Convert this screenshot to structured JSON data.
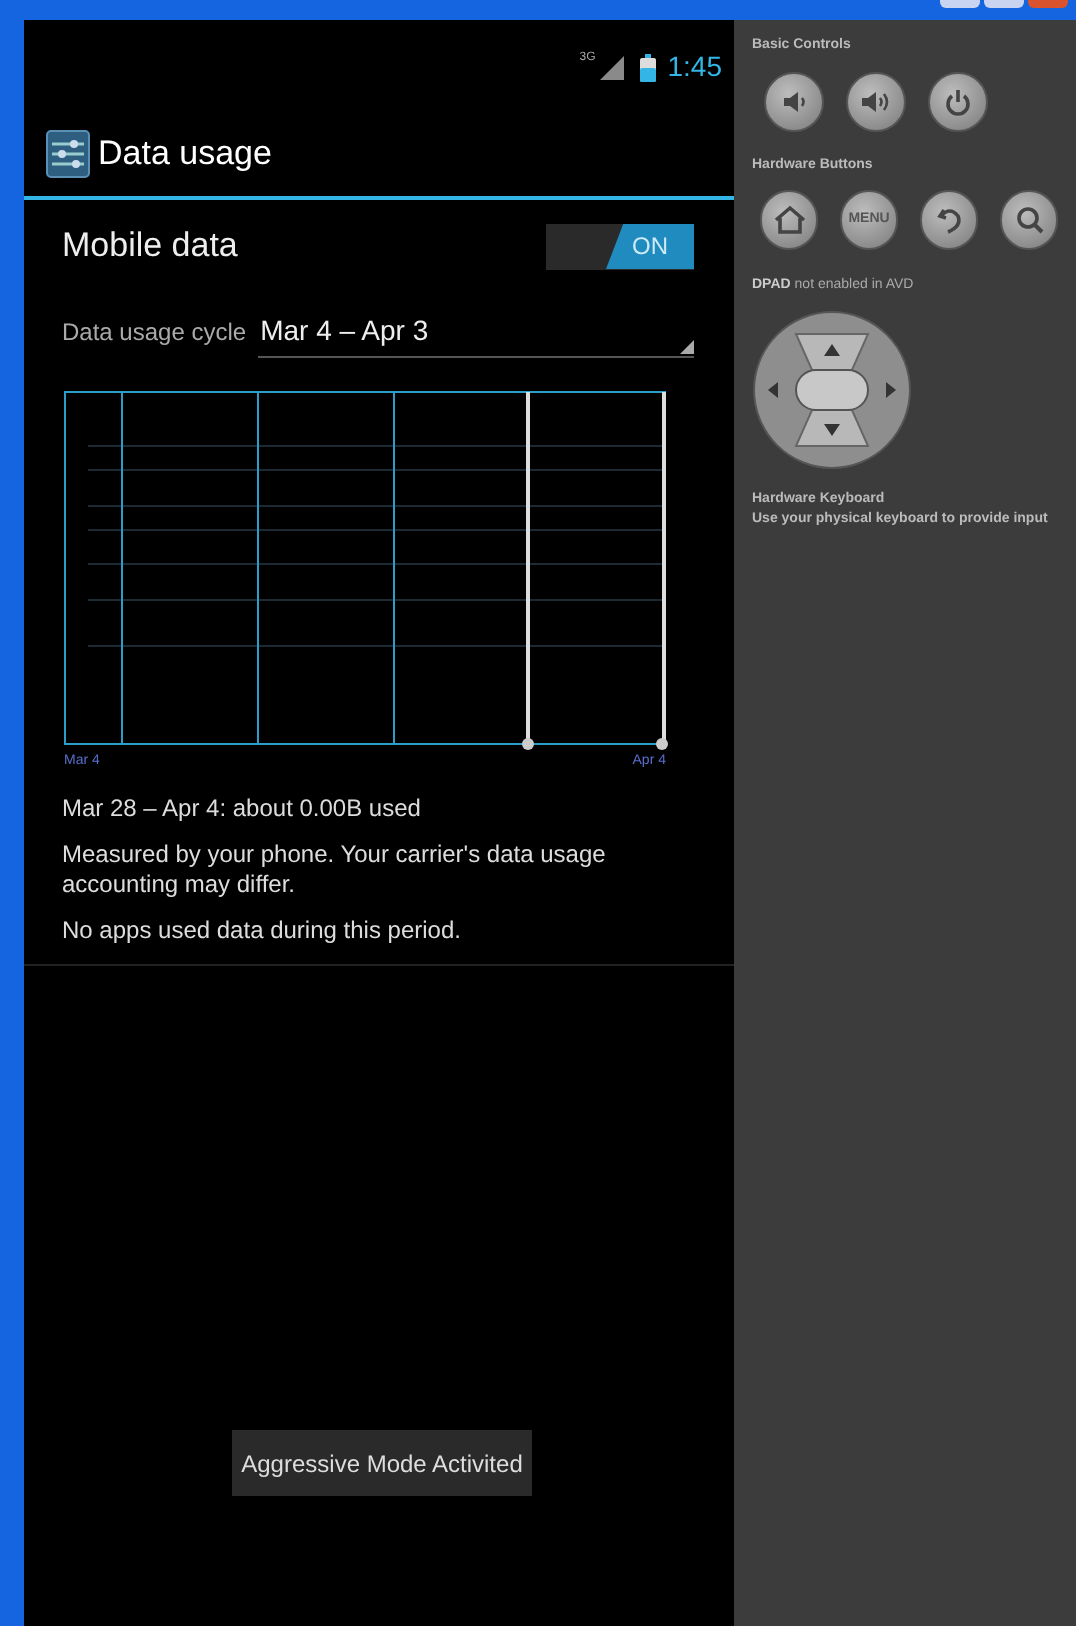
{
  "status_bar": {
    "network": "3G",
    "time": "1:45"
  },
  "action_bar": {
    "title": "Data usage"
  },
  "mobile_data": {
    "label": "Mobile data",
    "on": true,
    "switch_text": "ON"
  },
  "cycle": {
    "label": "Data usage cycle",
    "value": "Mar 4 – Apr 3"
  },
  "chart": {
    "start_label": "Mar 4",
    "end_label": "Apr 4"
  },
  "summary": "Mar 28 – Apr 4: about 0.00B used",
  "notes": [
    "Measured by your phone. Your carrier's data usage accounting may differ.",
    "No apps used data during this period."
  ],
  "toast": "Aggressive Mode Activited",
  "emulator_panel": {
    "basic_controls": "Basic Controls",
    "hardware_buttons": "Hardware Buttons",
    "menu_key": "MENU",
    "dpad_bold": "DPAD",
    "dpad_note": "not enabled in AVD",
    "keyboard_title": "Hardware Keyboard",
    "keyboard_note": "Use your physical keyboard to provide input"
  }
}
